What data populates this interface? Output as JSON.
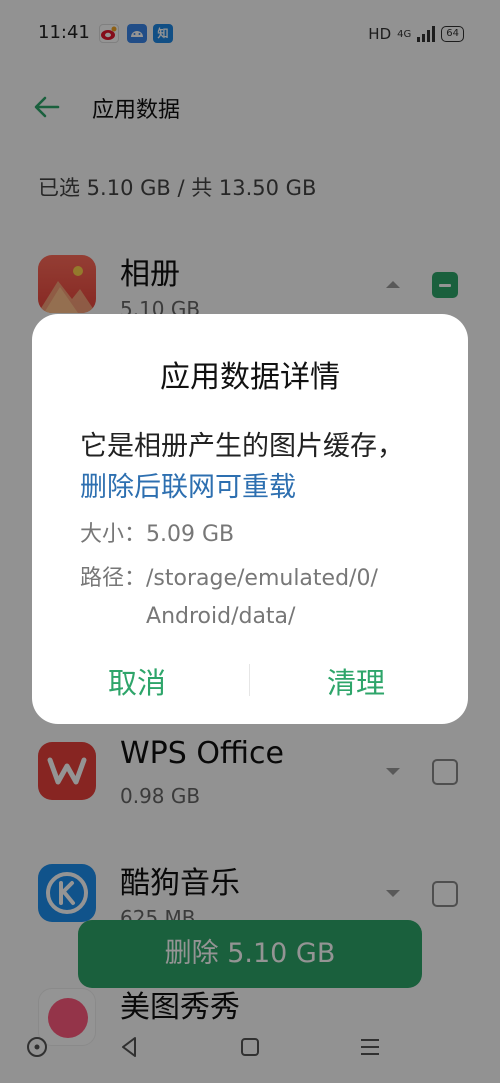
{
  "status_bar": {
    "time": "11:41",
    "notification_icons": [
      {
        "name": "weibo-icon",
        "color": "#e6162d"
      },
      {
        "name": "android-icon",
        "color": "#3a86e8"
      },
      {
        "name": "zhihu-icon",
        "color": "#1e88e5",
        "glyph": "知"
      }
    ],
    "hd": "HD",
    "network": "4G",
    "battery": "64"
  },
  "header": {
    "title": "应用数据"
  },
  "summary": "已选 5.10 GB / 共 13.50 GB",
  "apps": [
    {
      "name": "相册",
      "size": "5.10 GB",
      "icon": "gallery-icon",
      "checked": "partial"
    },
    {
      "name": "WPS Office",
      "size": "0.98 GB",
      "icon": "wps-office-icon",
      "checked": "none"
    },
    {
      "name": "酷狗音乐",
      "size": "625 MB",
      "icon": "kugou-music-icon",
      "checked": "none"
    },
    {
      "name": "美图秀秀",
      "size": "",
      "icon": "meitu-icon",
      "checked": "none"
    }
  ],
  "delete_button": "删除 5.10 GB",
  "dialog": {
    "title": "应用数据详情",
    "message_plain": "它是相册产生的图片缓存，",
    "message_link": "删除后联网可重载",
    "size_label": "大小：",
    "size_value": "5.09 GB",
    "path_label": "路径：",
    "path_value": "/storage/emulated/0/Android/data/",
    "cancel": "取消",
    "confirm": "清理"
  },
  "colors": {
    "accent": "#2ea56a",
    "link": "#2d6fb0"
  }
}
